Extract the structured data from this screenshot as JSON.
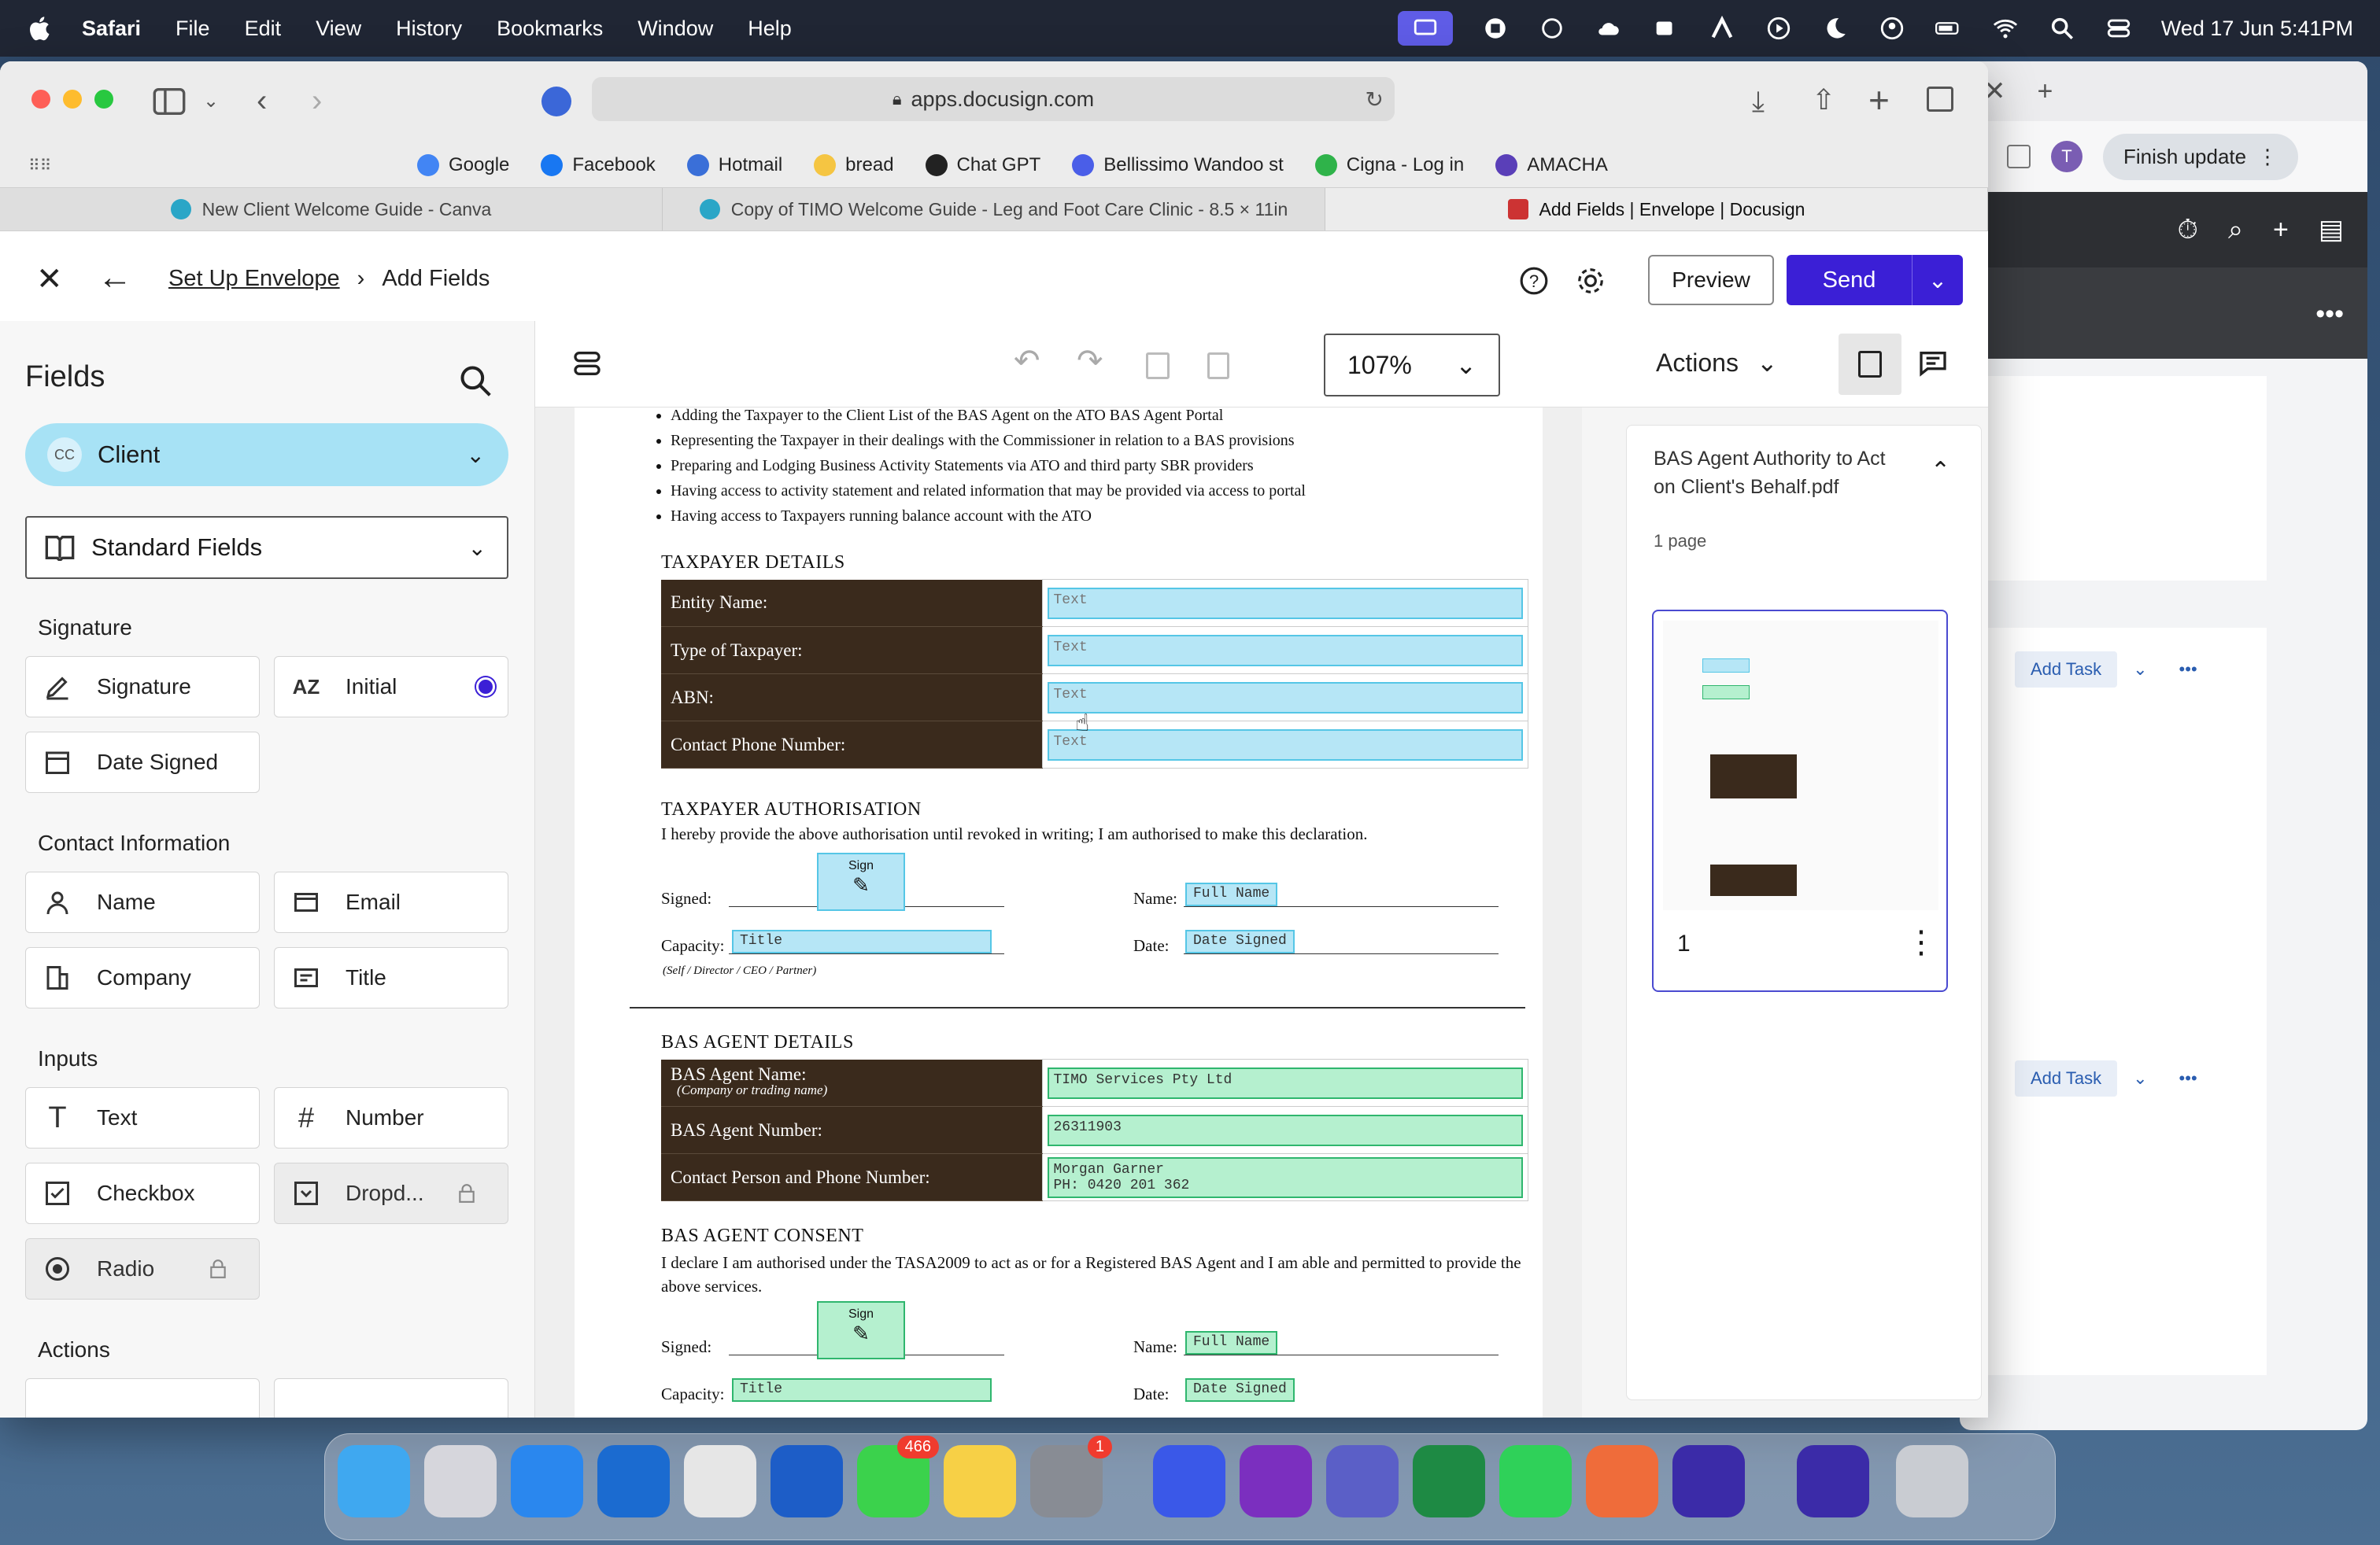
{
  "menubar": {
    "app": "Safari",
    "items": [
      "File",
      "Edit",
      "View",
      "History",
      "Bookmarks",
      "Window",
      "Help"
    ],
    "datetime": "Wed 17 Jun  5:41PM"
  },
  "browser": {
    "url": "apps.docusign.com",
    "bookmarks": [
      {
        "label": "Google",
        "color": "#4285f4"
      },
      {
        "label": "Facebook",
        "color": "#1877f2"
      },
      {
        "label": "Hotmail",
        "color": "#3a6fd8"
      },
      {
        "label": "bread",
        "color": "#f5c542"
      },
      {
        "label": "Chat GPT",
        "color": "#222222"
      },
      {
        "label": "Bellissimo Wandoo st",
        "color": "#4a5ee8"
      },
      {
        "label": "Cigna - Log in",
        "color": "#2fb34a"
      },
      {
        "label": "AMACHA",
        "color": "#5a3fb8"
      }
    ],
    "tabs": [
      "New Client Welcome Guide - Canva",
      "Copy of TIMO Welcome Guide - Leg and Foot Care Clinic - 8.5 × 11in",
      "Add Fields | Envelope | Docusign"
    ]
  },
  "bgwin": {
    "finish_update": "Finish update",
    "avatar": "T",
    "add_task": "Add Task"
  },
  "header": {
    "crumb_1": "Set Up Envelope",
    "crumb_2": "Add Fields",
    "preview": "Preview",
    "send": "Send"
  },
  "sidebar": {
    "title": "Fields",
    "recipient_initials": "CC",
    "recipient": "Client",
    "field_set": "Standard Fields",
    "sections": {
      "signature": "Signature",
      "contact": "Contact Information",
      "inputs": "Inputs",
      "actions": "Actions"
    },
    "fields": {
      "signature": "Signature",
      "initial": "Initial",
      "date_signed": "Date Signed",
      "name": "Name",
      "email": "Email",
      "company": "Company",
      "title": "Title",
      "text": "Text",
      "number": "Number",
      "checkbox": "Checkbox",
      "dropdown": "Dropd...",
      "radio": "Radio"
    }
  },
  "toolbar": {
    "zoom": "107%",
    "actions": "Actions"
  },
  "document": {
    "bullets": [
      "Adding the Taxpayer to the Client List of the BAS Agent on the ATO BAS Agent Portal",
      "Representing the Taxpayer in their dealings with the Commissioner in relation to a BAS provisions",
      "Preparing and Lodging Business Activity Statements via ATO and third party SBR providers",
      "Having access to activity statement and related information that may be provided via access to portal",
      "Having access to Taxpayers running balance account with the ATO"
    ],
    "taxpayer_details_heading": "TAXPAYER DETAILS",
    "taxpayer_rows": [
      {
        "label": "Entity Name:",
        "field": "Text"
      },
      {
        "label": "Type of Taxpayer:",
        "field": "Text"
      },
      {
        "label": "ABN:",
        "field": "Text"
      },
      {
        "label": "Contact Phone Number:",
        "field": "Text"
      }
    ],
    "taxpayer_auth_heading": "TAXPAYER AUTHORISATION",
    "taxpayer_auth_text": "I hereby provide the above authorisation until revoked in writing; I am authorised to make this declaration.",
    "signed_label": "Signed:",
    "name_label": "Name:",
    "capacity_label": "Capacity:",
    "date_label": "Date:",
    "capacity_hint": "(Self / Director / CEO / Partner)",
    "sign_tag": "Sign",
    "full_name_tag": "Full Name",
    "title_tag": "Title",
    "date_signed_tag": "Date Signed",
    "bas_agent_heading": "BAS AGENT DETAILS",
    "bas_rows": [
      {
        "label": "BAS Agent Name:",
        "sub": "(Company or trading name)",
        "value": "TIMO Services Pty Ltd"
      },
      {
        "label": "BAS Agent Number:",
        "sub": "",
        "value": "26311903"
      },
      {
        "label": "Contact Person and Phone Number:",
        "sub": "",
        "value": "Morgan Garner\nPH: 0420 201 362"
      }
    ],
    "bas_consent_heading": "BAS AGENT CONSENT",
    "bas_consent_text": "I declare I am authorised under the TASA2009 to act as or for a Registered BAS Agent and I am able and permitted to provide the above services."
  },
  "thumbs": {
    "filename": "BAS Agent Authority to Act on Client's Behalf.pdf",
    "pages": "1 page",
    "page_number": "1"
  },
  "dock": {
    "messages_badge": "466",
    "settings_badge": "1"
  }
}
